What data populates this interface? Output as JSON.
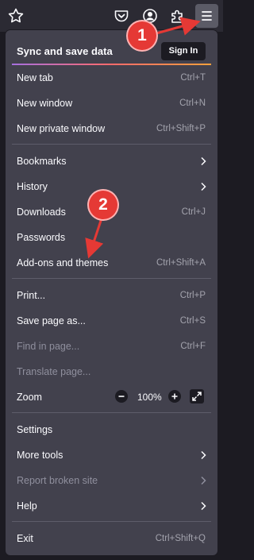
{
  "toolbar": {
    "icons": [
      "star-icon",
      "pocket-icon",
      "account-icon",
      "extensions-icon",
      "menu-icon"
    ]
  },
  "menu": {
    "sync_title": "Sync and save data",
    "sign_in": "Sign In",
    "items": {
      "new_tab": {
        "label": "New tab",
        "shortcut": "Ctrl+T"
      },
      "new_window": {
        "label": "New window",
        "shortcut": "Ctrl+N"
      },
      "new_private": {
        "label": "New private window",
        "shortcut": "Ctrl+Shift+P"
      },
      "bookmarks": {
        "label": "Bookmarks"
      },
      "history": {
        "label": "History"
      },
      "downloads": {
        "label": "Downloads",
        "shortcut": "Ctrl+J"
      },
      "passwords": {
        "label": "Passwords"
      },
      "addons": {
        "label": "Add-ons and themes",
        "shortcut": "Ctrl+Shift+A"
      },
      "print": {
        "label": "Print...",
        "shortcut": "Ctrl+P"
      },
      "save_page": {
        "label": "Save page as...",
        "shortcut": "Ctrl+S"
      },
      "find": {
        "label": "Find in page...",
        "shortcut": "Ctrl+F"
      },
      "translate": {
        "label": "Translate page..."
      },
      "zoom": {
        "label": "Zoom",
        "value": "100%"
      },
      "settings": {
        "label": "Settings"
      },
      "more_tools": {
        "label": "More tools"
      },
      "report_broken": {
        "label": "Report broken site"
      },
      "help": {
        "label": "Help"
      },
      "exit": {
        "label": "Exit",
        "shortcut": "Ctrl+Shift+Q"
      }
    }
  },
  "annotations": {
    "step1": "1",
    "step2": "2"
  },
  "colors": {
    "accent_annotation": "#e53935",
    "menu_bg": "#42414d",
    "toolbar_bg": "#2b2a33"
  }
}
